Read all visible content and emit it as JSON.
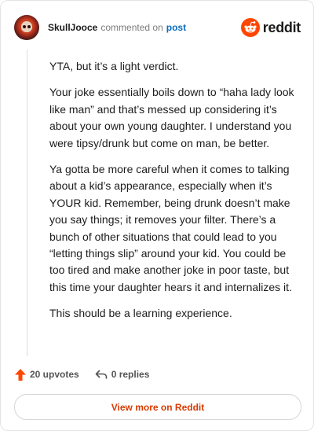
{
  "header": {
    "username": "SkullJooce",
    "action": "commented on",
    "post_link": "post",
    "brand": "reddit"
  },
  "comment": {
    "paragraphs": [
      "YTA, but it’s a light verdict.",
      "Your joke essentially boils down to “haha lady look like man” and that’s messed up considering it’s about your own young daughter. I understand you were tipsy/drunk but come on man, be better.",
      "Ya gotta be more careful when it comes to talking about a kid’s appearance, especially when it’s YOUR kid. Remember, being drunk doesn’t make you say things; it removes your filter. There’s a bunch of other situations that could lead to you “letting things slip” around your kid. You could be too tired and make another joke in poor taste, but this time your daughter hears it and internalizes it.",
      "This should be a learning experience."
    ]
  },
  "footer": {
    "upvotes": "20 upvotes",
    "replies": "0 replies"
  },
  "view_more": "View more on Reddit",
  "colors": {
    "accent": "#ff4500",
    "link": "#0a6bbf",
    "view_more_text": "#d93a00"
  },
  "icons": {
    "avatar": "skull-avatar",
    "brand": "reddit-snoo-icon",
    "upvote": "upvote-arrow-icon",
    "reply": "reply-arrow-icon"
  }
}
